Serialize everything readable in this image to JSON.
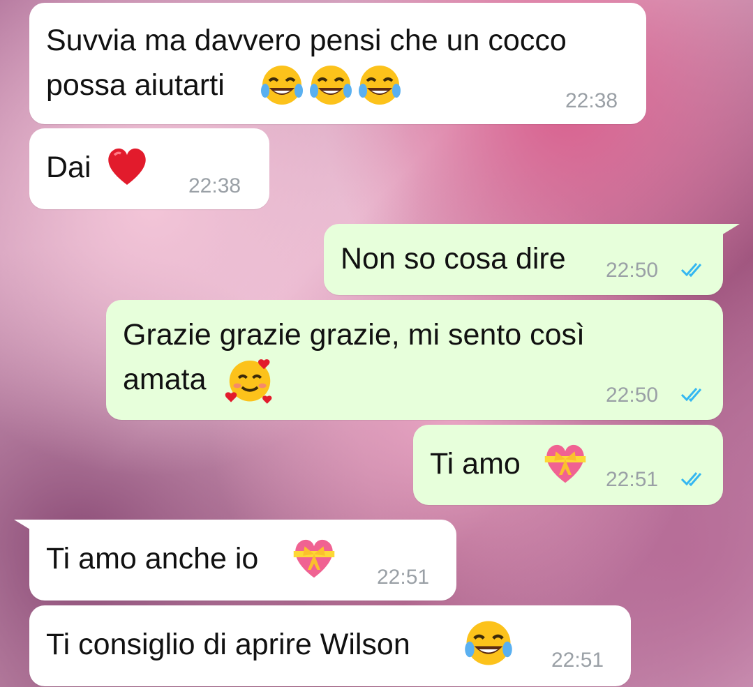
{
  "messages": [
    {
      "text": "Suvvia ma davvero pensi che un cocco\npossa aiutarti",
      "time": "22:38",
      "emoji": [
        "laugh-cry",
        "laugh-cry",
        "laugh-cry"
      ],
      "direction": "in"
    },
    {
      "text": "Dai",
      "time": "22:38",
      "emoji": [
        "red-heart"
      ],
      "direction": "in"
    },
    {
      "text": "Non so cosa dire",
      "time": "22:50",
      "emoji": [],
      "direction": "out",
      "status": "read"
    },
    {
      "text": "Grazie grazie grazie, mi sento così\namata",
      "time": "22:50",
      "emoji": [
        "smiling-hearts"
      ],
      "direction": "out",
      "status": "read"
    },
    {
      "text": "Ti amo",
      "time": "22:51",
      "emoji": [
        "gift-heart"
      ],
      "direction": "out",
      "status": "read"
    },
    {
      "text": "Ti amo anche io",
      "time": "22:51",
      "emoji": [
        "gift-heart"
      ],
      "direction": "in"
    },
    {
      "text": "Ti consiglio di aprire Wilson",
      "time": "22:51",
      "emoji": [
        "laugh-cry"
      ],
      "direction": "in"
    }
  ],
  "colors": {
    "incoming": "#ffffff",
    "outgoing": "#e7ffdb",
    "read_ticks": "#34b7f1",
    "time": "#9aa0a6"
  }
}
